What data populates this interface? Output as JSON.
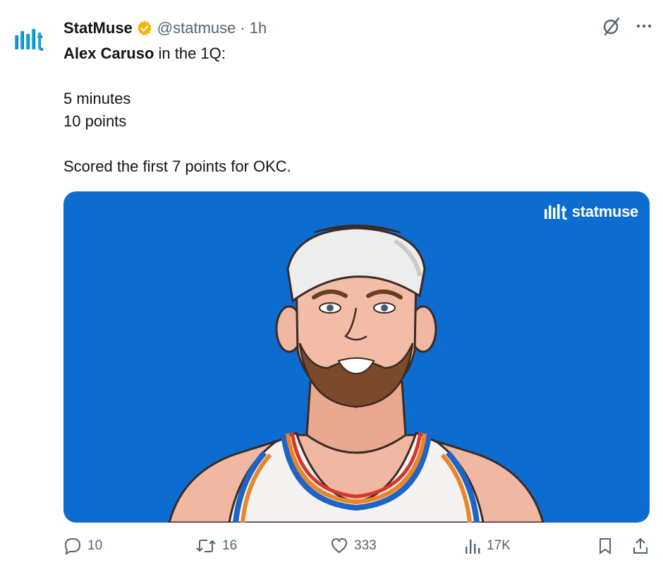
{
  "tweet": {
    "author": {
      "display_name": "StatMuse",
      "handle": "@statmuse",
      "separator": "·",
      "time": "1h",
      "verified_color": "#f4b400",
      "avatar_icon": "statmuse-logo-icon"
    },
    "text": {
      "line1_bold": "Alex Caruso",
      "line1_rest": " in the 1Q:",
      "line2": "5 minutes",
      "line3": "10 points",
      "line4": "Scored the first 7 points for OKC."
    },
    "media": {
      "brand_label": "statmuse",
      "background": "#0c6ccf",
      "illustration": "basketball-player-portrait"
    },
    "actions": {
      "replies": "10",
      "reposts": "16",
      "likes": "333",
      "views": "17K"
    }
  }
}
